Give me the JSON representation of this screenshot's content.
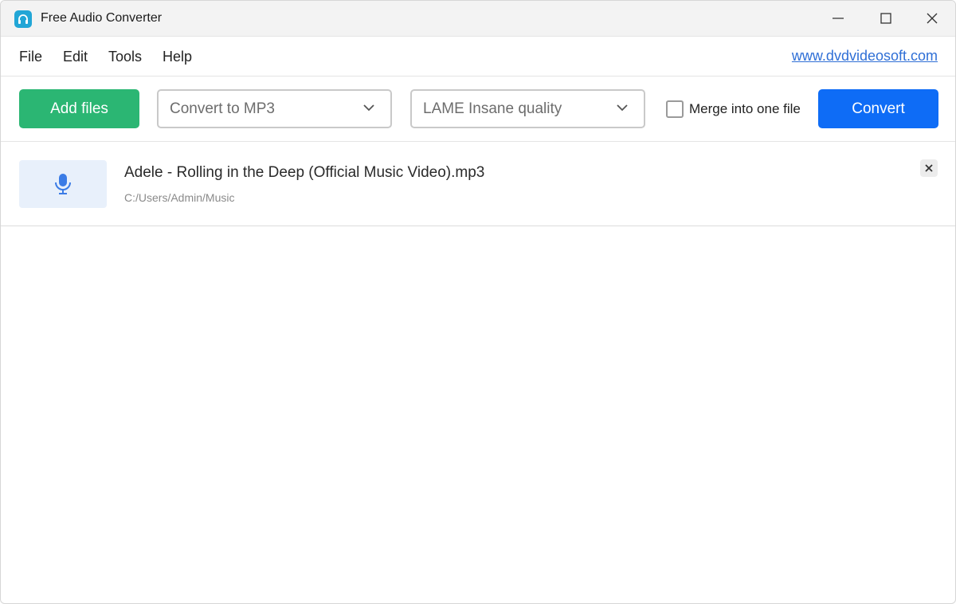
{
  "window": {
    "title": "Free Audio Converter",
    "icon": "headphones-icon",
    "controls": [
      "minimize-icon",
      "maximize-icon",
      "close-icon"
    ]
  },
  "menu": {
    "file": "File",
    "edit": "Edit",
    "tools": "Tools",
    "help": "Help",
    "link": "www.dvdvideosoft.com"
  },
  "toolbar": {
    "add_files": "Add files",
    "format_select": "Convert to MP3",
    "quality_select": "LAME Insane quality",
    "merge_label": "Merge into one file",
    "merge_checked": false,
    "convert": "Convert"
  },
  "files": [
    {
      "name": "Adele - Rolling in the Deep (Official Music Video).mp3",
      "path": "C:/Users/Admin/Music",
      "icon": "microphone-icon"
    }
  ],
  "colors": {
    "add_button": "#2bb673",
    "convert_button": "#0e6cf6",
    "link": "#2f6fd6",
    "app_icon": "#22a6d6"
  }
}
